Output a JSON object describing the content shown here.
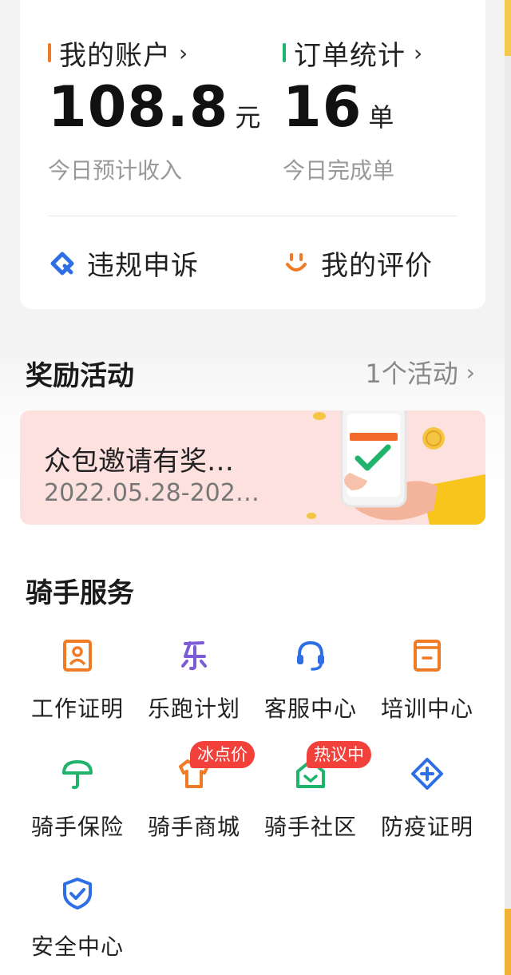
{
  "account": {
    "title": "我的账户",
    "value": "108.8",
    "unit": "元",
    "sub": "今日预计收入",
    "bar_color": "#f07b27"
  },
  "orders": {
    "title": "订单统计",
    "value": "16",
    "unit": "单",
    "sub": "今日完成单",
    "bar_color": "#1fb36b"
  },
  "quick_actions": [
    {
      "label": "违规申诉",
      "icon": "appeal-icon",
      "color": "#2f6fe6"
    },
    {
      "label": "我的评价",
      "icon": "smile-icon",
      "color": "#f07b27"
    }
  ],
  "rewards": {
    "title": "奖励活动",
    "more": "1个活动",
    "banner": {
      "title": "众包邀请有奖…",
      "date": "2022.05.28-202…"
    }
  },
  "services": {
    "title": "骑手服务",
    "items": [
      {
        "label": "工作证明",
        "icon": "id-card-icon",
        "color": "#f07b27"
      },
      {
        "label": "乐跑计划",
        "icon": "le-icon",
        "color": "#7b5cd6"
      },
      {
        "label": "客服中心",
        "icon": "headset-icon",
        "color": "#2f6fe6"
      },
      {
        "label": "培训中心",
        "icon": "book-icon",
        "color": "#f07b27"
      },
      {
        "label": "骑手保险",
        "icon": "umbrella-icon",
        "color": "#1fb36b"
      },
      {
        "label": "骑手商城",
        "icon": "shirt-icon",
        "color": "#f07b27",
        "badge": "冰点价"
      },
      {
        "label": "骑手社区",
        "icon": "house-icon",
        "color": "#1fb36b",
        "badge": "热议中"
      },
      {
        "label": "防疫证明",
        "icon": "diamond-plus-icon",
        "color": "#2f6fe6"
      },
      {
        "label": "安全中心",
        "icon": "shield-check-icon",
        "color": "#2f6fe6"
      }
    ]
  }
}
